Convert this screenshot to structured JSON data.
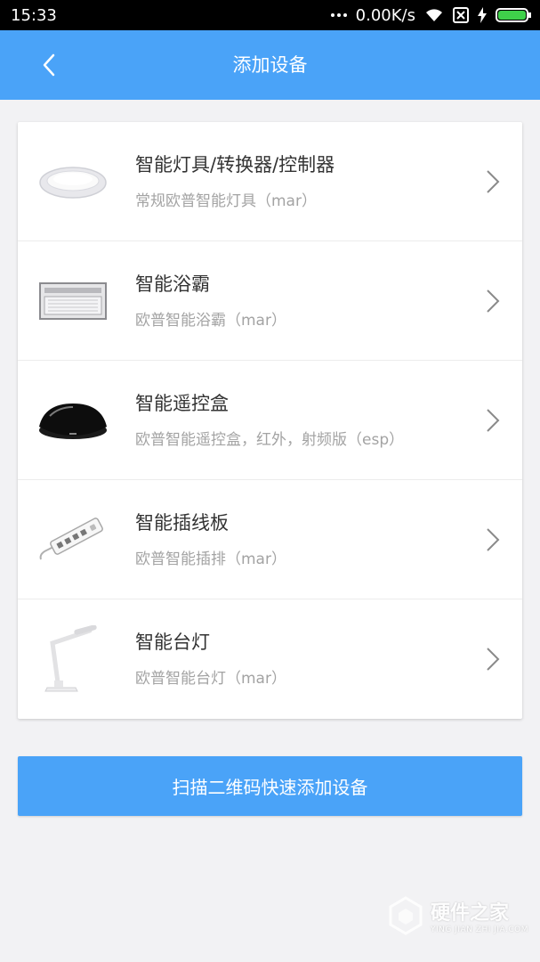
{
  "status": {
    "time": "15:33",
    "speed": "0.00K/s"
  },
  "header": {
    "title": "添加设备",
    "back_icon": "back-arrow-icon"
  },
  "devices": [
    {
      "name": "智能灯具/转换器/控制器",
      "subtitle": "常规欧普智能灯具（mar）",
      "icon": "ceiling-lamp-icon"
    },
    {
      "name": "智能浴霸",
      "subtitle": "欧普智能浴霸（mar）",
      "icon": "bath-heater-icon"
    },
    {
      "name": "智能遥控盒",
      "subtitle": "欧普智能遥控盒，红外，射频版（esp）",
      "icon": "remote-box-icon"
    },
    {
      "name": "智能插线板",
      "subtitle": "欧普智能插排（mar）",
      "icon": "power-strip-icon"
    },
    {
      "name": "智能台灯",
      "subtitle": "欧普智能台灯（mar）",
      "icon": "desk-lamp-icon"
    }
  ],
  "scan_button": {
    "label": "扫描二维码快速添加设备"
  },
  "watermark": {
    "cn": "硬件之家",
    "en": "YING JIAN ZHI JIA.COM"
  },
  "colors": {
    "accent": "#4aa3f8",
    "background": "#f2f2f4"
  }
}
